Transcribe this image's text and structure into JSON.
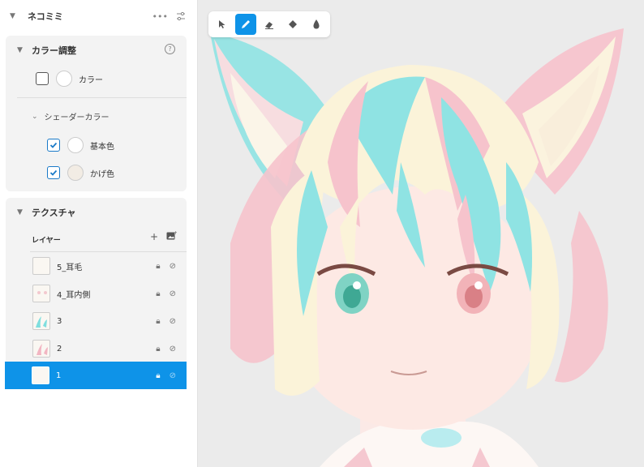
{
  "header": {
    "title": "ネコミミ"
  },
  "color_adjust": {
    "title": "カラー調整",
    "help": "?",
    "color_label": "カラー",
    "shader": {
      "title": "シェーダーカラー",
      "base_label": "基本色",
      "shade_label": "かげ色"
    }
  },
  "texture": {
    "title": "テクスチャ",
    "layer_header": "レイヤー",
    "layers": [
      {
        "name": "5_耳毛"
      },
      {
        "name": "4_耳内側"
      },
      {
        "name": "3"
      },
      {
        "name": "2"
      },
      {
        "name": "1"
      }
    ]
  },
  "colors": {
    "accent": "#0e93e8"
  }
}
